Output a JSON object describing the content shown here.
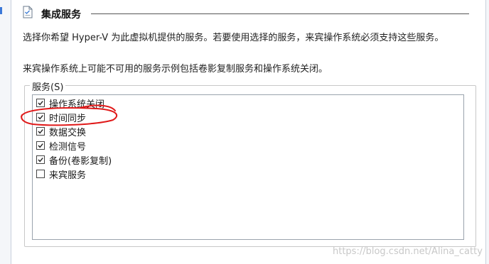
{
  "header": {
    "icon": "document-icon",
    "title": "集成服务"
  },
  "description": {
    "line1": "选择你希望 Hyper-V 为此虚拟机提供的服务。若要使用选择的服务，来宾操作系统必须支持这些服务。",
    "line2": "来宾操作系统上可能不可用的服务示例包括卷影复制服务和操作系统关闭。"
  },
  "services": {
    "label": "服务(S)",
    "items": [
      {
        "label": "操作系统关闭",
        "checked": true
      },
      {
        "label": "时间同步",
        "checked": true
      },
      {
        "label": "数据交换",
        "checked": true
      },
      {
        "label": "检测信号",
        "checked": true
      },
      {
        "label": "备份(卷影复制)",
        "checked": true
      },
      {
        "label": "来宾服务",
        "checked": false
      }
    ]
  },
  "annotation": {
    "color": "#e01919"
  },
  "watermark": "https://blog.csdn.net/Alina_catty"
}
